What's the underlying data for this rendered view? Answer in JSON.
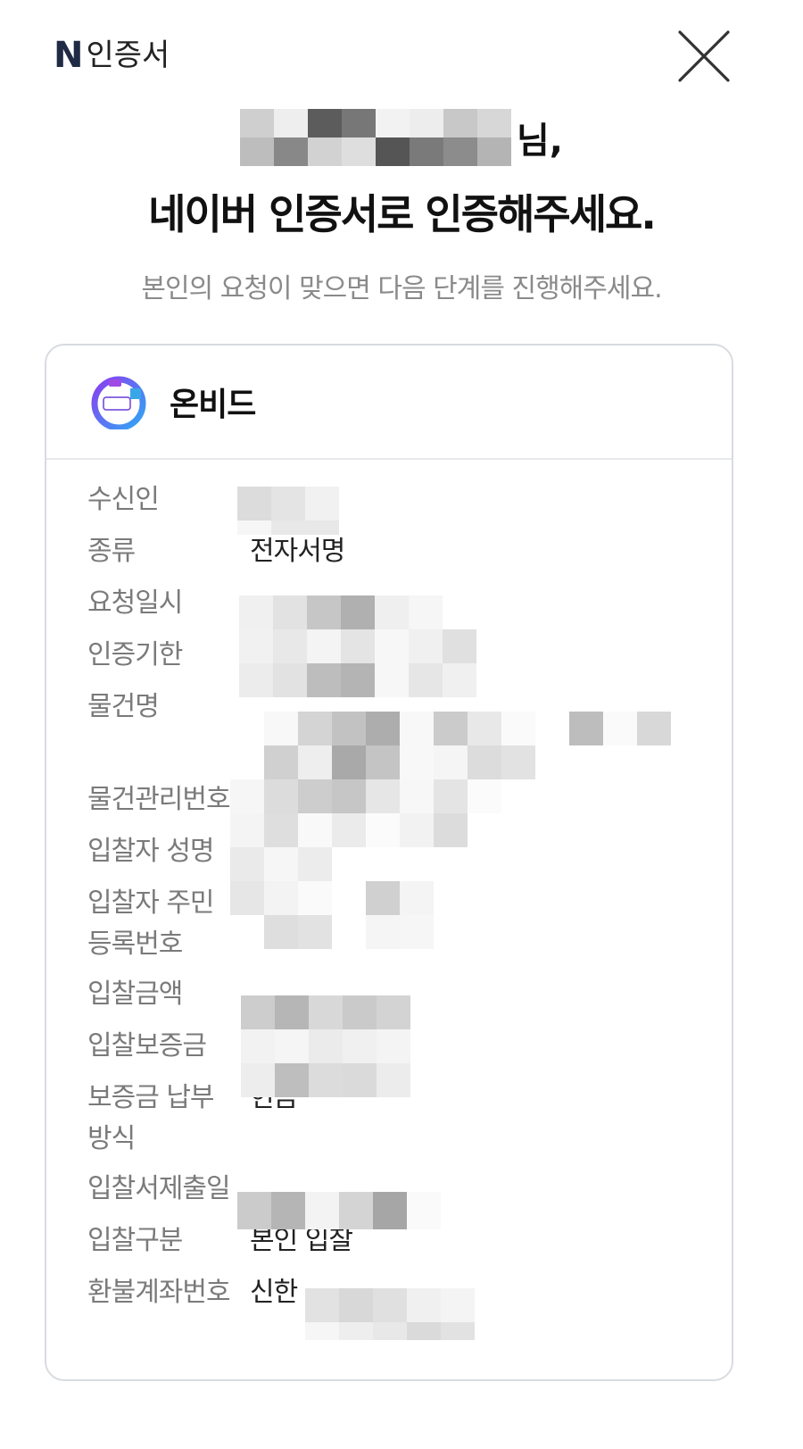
{
  "header": {
    "brand_mark": "N",
    "brand_label": "인증서",
    "close_icon": "close-icon"
  },
  "hero": {
    "name_suffix": "님,",
    "headline": "네이버 인증서로 인증해주세요.",
    "subline": "본인의 요청이 맞으면 다음 단계를 진행해주세요."
  },
  "card": {
    "service_name": "온비드",
    "service_logo_icon": "onbid-logo-icon",
    "rows": [
      {
        "label": "수신인",
        "value": ""
      },
      {
        "label": "종류",
        "value": "전자서명"
      },
      {
        "label": "요청일시",
        "value": ""
      },
      {
        "label": "인증기한",
        "value": ""
      },
      {
        "label": "물건명",
        "value": ""
      },
      {
        "label": "물건관리번호",
        "value": ""
      },
      {
        "label": "입찰자 성명",
        "value": ""
      },
      {
        "label": "입찰자 주민\n등록번호",
        "value": ""
      },
      {
        "label": "입찰금액",
        "value": ""
      },
      {
        "label": "입찰보증금",
        "value": ""
      },
      {
        "label": "보증금 납부\n방식",
        "value": "현금"
      },
      {
        "label": "입찰서제출일",
        "value": ""
      },
      {
        "label": "입찰구분",
        "value": "본인 입찰"
      },
      {
        "label": "환불계좌번호",
        "value": "신한"
      }
    ]
  },
  "colors": {
    "accent": "#1f2a44",
    "label_gray": "#7a7a7a",
    "border": "#d8dbe0"
  }
}
